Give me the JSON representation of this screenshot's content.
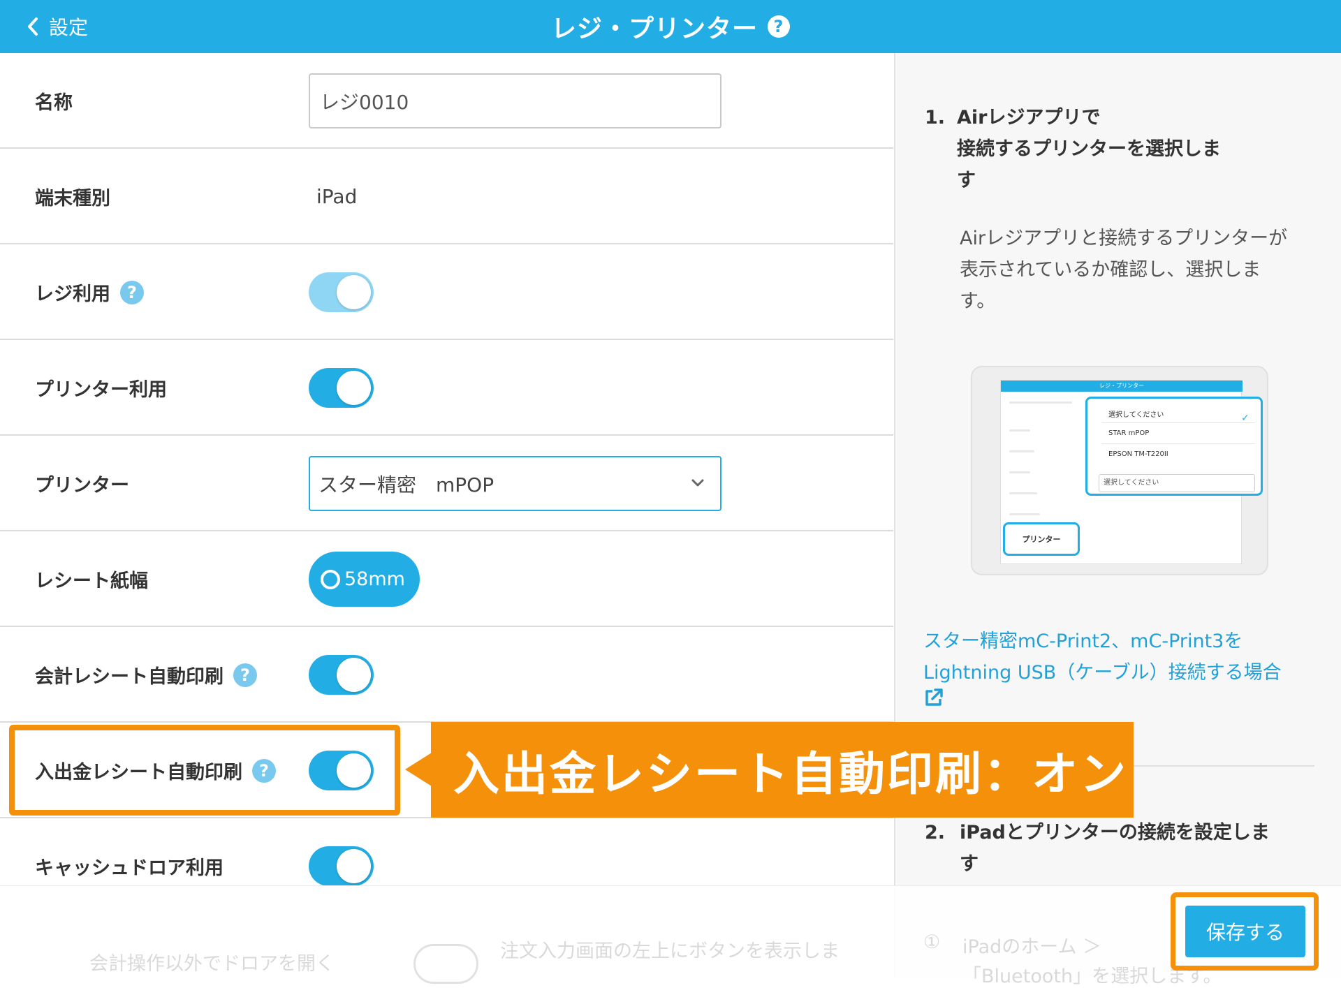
{
  "header": {
    "back_label": "設定",
    "title": "レジ・プリンター",
    "help_mark": "?"
  },
  "settings": {
    "name_label": "名称",
    "name_value": "レジ0010",
    "device_label": "端末種別",
    "device_value": "iPad",
    "register_use_label": "レジ利用",
    "register_use_on": true,
    "printer_use_label": "プリンター利用",
    "printer_use_on": true,
    "printer_label": "プリンター",
    "printer_value": "スター精密　mPOP",
    "paper_width_label": "レシート紙幅",
    "paper_width_value": "58mm",
    "auto_print_sale_label": "会計レシート自動印刷",
    "auto_print_sale_on": true,
    "auto_print_cash_label": "入出金レシート自動印刷",
    "auto_print_cash_on": true,
    "drawer_use_label": "キャッシュドロア利用",
    "drawer_use_on": true,
    "help_mark": "?"
  },
  "callout": {
    "text": "入出金レシート自動印刷：オン"
  },
  "help_panel": {
    "step1_num": "1.",
    "step1_line1": "Airレジアプリで",
    "step1_line2": "接続するプリンターを選択しま",
    "step1_line3": "す",
    "step1_desc": "Airレジアプリと接続するプリンターが表示されているか確認し、選択します。",
    "thumb_title": "レジ・プリンター",
    "thumb_opt1": "選択してください",
    "thumb_opt2": "STAR mPOP",
    "thumb_opt3": "EPSON TM-T220II",
    "thumb_select": "選択してください",
    "thumb_printer": "プリンター",
    "link_text": "スター精密mC-Print2、mC-Print3をLightning USB（ケーブル）接続する場合",
    "step2_num": "2.",
    "step2_line1": "iPadとプリンターの接続を設定しま",
    "step2_line2": "す"
  },
  "bottom": {
    "faded_label": "会計操作以外でドロアを開く",
    "faded_desc": "注文入力画面の左上にボタンを表示しま",
    "faded_right_1": "iPadのホーム ＞",
    "faded_right_2": "「Bluetooth」を選択します。",
    "faded_num": "①",
    "save_label": "保存する"
  },
  "colors": {
    "accent": "#22ade4",
    "highlight": "#f5900a"
  }
}
